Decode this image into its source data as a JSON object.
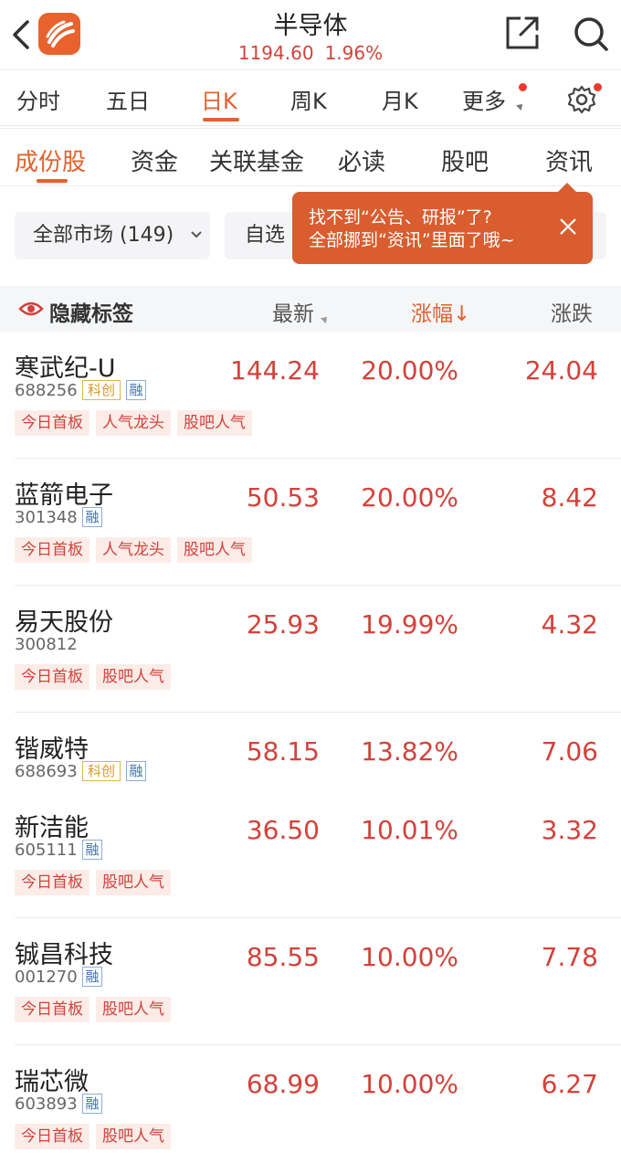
{
  "header": {
    "title": "半导体",
    "price": "1194.60",
    "change": "1.96%"
  },
  "period_tabs": [
    "分时",
    "五日",
    "日K",
    "周K",
    "月K",
    "更多"
  ],
  "category_tabs": [
    "成份股",
    "资金",
    "关联基金",
    "必读",
    "股吧",
    "资讯"
  ],
  "filters": {
    "all_markets": "全部市场 (149)",
    "watchlist": "自选"
  },
  "tooltip": {
    "line1": "找不到“公告、研报”了?",
    "line2": "全部挪到“资讯”里面了哦~"
  },
  "table_header": {
    "hide_tags": "隐藏标签",
    "latest": "最新",
    "change_pct": "涨幅↓",
    "change": "涨跌"
  },
  "rows": [
    {
      "name": "寒武纪-U",
      "code": "688256",
      "badges": [
        "科创",
        "融"
      ],
      "latest": "144.24",
      "pct": "20.00%",
      "chg": "24.04",
      "tags": [
        "今日首板",
        "人气龙头",
        "股吧人气"
      ]
    },
    {
      "name": "蓝箭电子",
      "code": "301348",
      "badges": [
        "融"
      ],
      "latest": "50.53",
      "pct": "20.00%",
      "chg": "8.42",
      "tags": [
        "今日首板",
        "人气龙头",
        "股吧人气"
      ]
    },
    {
      "name": "易天股份",
      "code": "300812",
      "badges": [],
      "latest": "25.93",
      "pct": "19.99%",
      "chg": "4.32",
      "tags": [
        "今日首板",
        "股吧人气"
      ]
    },
    {
      "name": "锴威特",
      "code": "688693",
      "badges": [
        "科创",
        "融"
      ],
      "latest": "58.15",
      "pct": "13.82%",
      "chg": "7.06",
      "tags": []
    },
    {
      "name": "新洁能",
      "code": "605111",
      "badges": [
        "融"
      ],
      "latest": "36.50",
      "pct": "10.01%",
      "chg": "3.32",
      "tags": [
        "今日首板",
        "股吧人气"
      ]
    },
    {
      "name": "铖昌科技",
      "code": "001270",
      "badges": [
        "融"
      ],
      "latest": "85.55",
      "pct": "10.00%",
      "chg": "7.78",
      "tags": [
        "今日首板",
        "股吧人气"
      ]
    },
    {
      "name": "瑞芯微",
      "code": "603893",
      "badges": [
        "融"
      ],
      "latest": "68.99",
      "pct": "10.00%",
      "chg": "6.27",
      "tags": [
        "今日首板",
        "股吧人气"
      ]
    }
  ],
  "colors": {
    "accent": "#e0622e",
    "rise": "#d2423b",
    "tooltip": "#d95d2f"
  }
}
